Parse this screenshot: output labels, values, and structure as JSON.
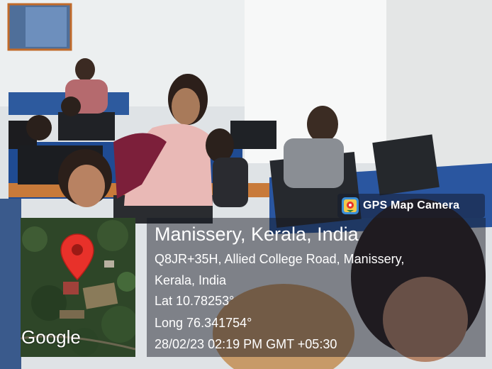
{
  "badge": {
    "label": "GPS Map Camera",
    "icon": "gps-map-camera-app-icon"
  },
  "map": {
    "logo_text": "Google",
    "pin_icon": "location-pin-icon",
    "pin_color": "#e8312a"
  },
  "location": {
    "title": "Manissery, Kerala, India",
    "address_line1": "Q8JR+35H, Allied College Road, Manissery,",
    "address_line2": "Kerala, India",
    "latitude": "Lat 10.78253°",
    "longitude": "Long 76.341754°",
    "timestamp": "28/02/23 02:19 PM GMT +05:30"
  }
}
